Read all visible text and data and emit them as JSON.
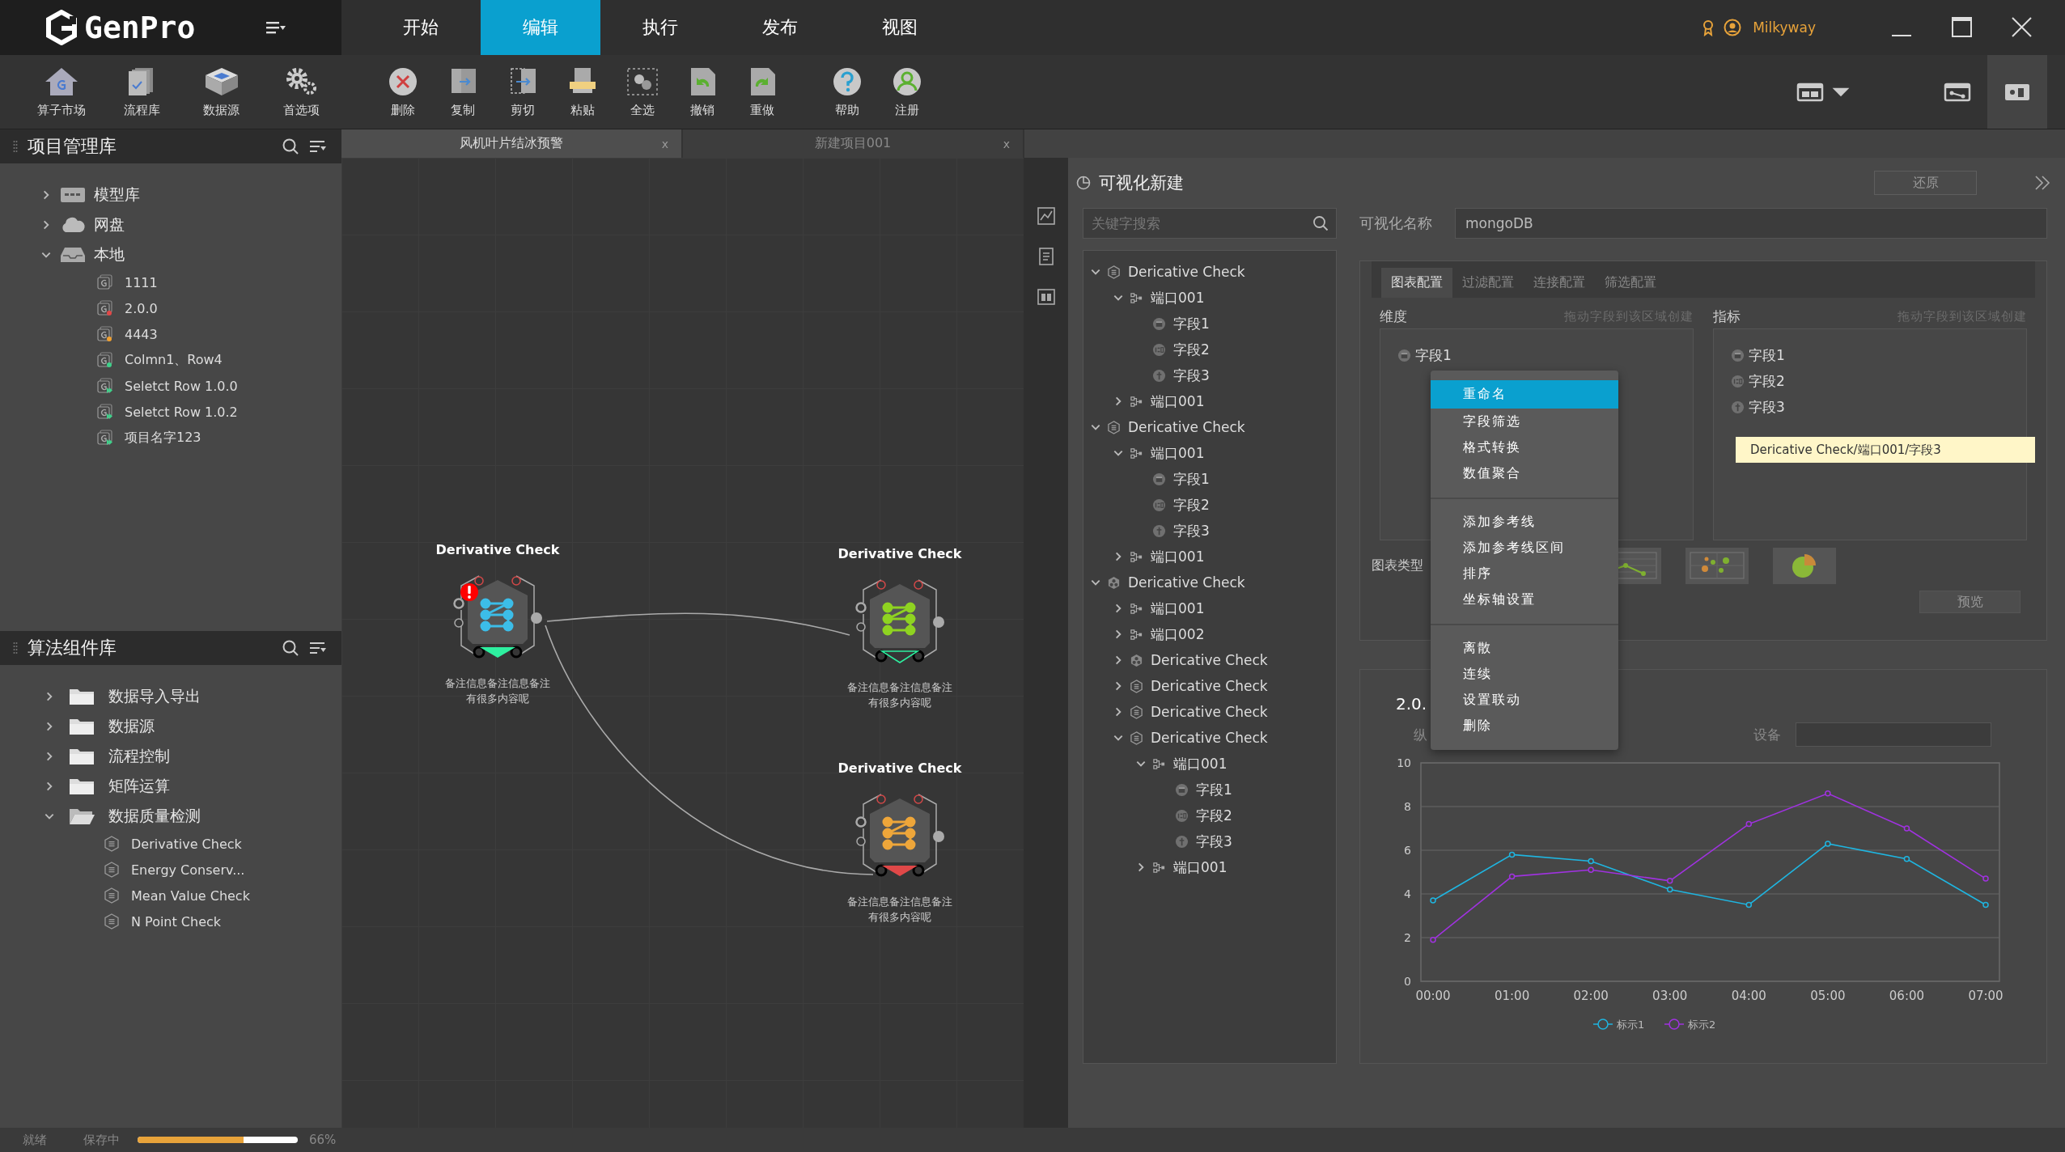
{
  "app": {
    "logo": "GenPro"
  },
  "menu_tabs": [
    {
      "label": "开始",
      "selected": false
    },
    {
      "label": "编辑",
      "selected": true
    },
    {
      "label": "执行",
      "selected": false
    },
    {
      "label": "发布",
      "selected": false
    },
    {
      "label": "视图",
      "selected": false
    }
  ],
  "user": {
    "name": "Milkyway"
  },
  "toolbar": {
    "primary": [
      {
        "label": "算子市场"
      },
      {
        "label": "流程库"
      },
      {
        "label": "数据源"
      },
      {
        "label": "首选项"
      }
    ],
    "edit": [
      {
        "label": "删除"
      },
      {
        "label": "复制"
      },
      {
        "label": "剪切"
      },
      {
        "label": "粘贴"
      },
      {
        "label": "全选"
      },
      {
        "label": "撤销"
      },
      {
        "label": "重做"
      }
    ],
    "help": [
      {
        "label": "帮助"
      },
      {
        "label": "注册"
      }
    ],
    "view_buttons": [
      {
        "selected": false
      },
      {
        "selected": false
      },
      {
        "selected": true
      }
    ]
  },
  "project_panel": {
    "title": "项目管理库",
    "tree": [
      {
        "label": "模型库",
        "kind": "model",
        "expanded": false
      },
      {
        "label": "网盘",
        "kind": "cloud",
        "expanded": false
      },
      {
        "label": "本地",
        "kind": "local",
        "expanded": true,
        "children": [
          {
            "label": "1111",
            "kind": "plain"
          },
          {
            "label": "2.0.0",
            "kind": "dot",
            "color": "#e04848"
          },
          {
            "label": "4443",
            "kind": "dot",
            "color": "#f0a030"
          },
          {
            "label": "Colmn1、Row4",
            "kind": "dot",
            "color": "#3fd08a"
          },
          {
            "label": "Seletct Row 1.0.0",
            "kind": "run",
            "color": "#3fd08a"
          },
          {
            "label": "Seletct Row 1.0.2",
            "kind": "run",
            "color": "#3fd08a"
          },
          {
            "label": "项目名字123",
            "kind": "run",
            "color": "#3fd08a"
          }
        ]
      }
    ]
  },
  "component_panel": {
    "title": "算法组件库",
    "tree": [
      {
        "label": "数据导入导出",
        "expanded": false
      },
      {
        "label": "数据源",
        "expanded": false
      },
      {
        "label": "流程控制",
        "expanded": false
      },
      {
        "label": "矩阵运算",
        "expanded": false
      },
      {
        "label": "数据质量检测",
        "expanded": true,
        "children": [
          {
            "label": "Derivative Check"
          },
          {
            "label": "Energy Conserv..."
          },
          {
            "label": "Mean Value Check"
          },
          {
            "label": "N Point Check"
          }
        ]
      }
    ]
  },
  "document_tabs": [
    {
      "label": "风机叶片结冰预警",
      "close": "x",
      "selected": true
    },
    {
      "label": "新建项目001",
      "close": "x",
      "selected": false
    }
  ],
  "canvas": {
    "nodes": [
      {
        "title": "Derivative Check",
        "note": "备注信息备注信息备注有很多内容呢",
        "color": "#3cbde8",
        "marker": {
          "color": "#2ef0a0",
          "filled": true
        },
        "error": true
      },
      {
        "title": "Derivative Check",
        "note": "备注信息备注信息备注有很多内容呢",
        "color": "#8fd321",
        "marker": {
          "color": "#2ef0a0",
          "filled": false
        },
        "error": false
      },
      {
        "title": "Derivative Check",
        "note": "备注信息备注信息备注有很多内容呢",
        "color": "#eea63a",
        "marker": {
          "color": "#e04848",
          "filled": true
        },
        "error": false
      }
    ]
  },
  "viz_panel": {
    "title": "可视化新建",
    "reset_button": "还原",
    "search": {
      "placeholder": "关键字搜索"
    },
    "field_tree": [
      {
        "label": "Dericative Check",
        "kind": "check",
        "expanded": true,
        "children": [
          {
            "label": "端口001",
            "kind": "port",
            "expanded": true,
            "children": [
              {
                "label": "字段1",
                "kind": "date"
              },
              {
                "label": "字段2",
                "kind": "number"
              },
              {
                "label": "字段3",
                "kind": "text"
              }
            ]
          },
          {
            "label": "端口001",
            "kind": "port",
            "expanded": false
          }
        ]
      },
      {
        "label": "Dericative Check",
        "kind": "check",
        "expanded": true,
        "children": [
          {
            "label": "端口001",
            "kind": "port",
            "expanded": true,
            "children": [
              {
                "label": "字段1",
                "kind": "date"
              },
              {
                "label": "字段2",
                "kind": "number"
              },
              {
                "label": "字段3",
                "kind": "text"
              }
            ]
          },
          {
            "label": "端口001",
            "kind": "port",
            "expanded": false
          }
        ]
      },
      {
        "label": "Dericative Check",
        "kind": "group",
        "expanded": true,
        "children": [
          {
            "label": "端口001",
            "kind": "port",
            "expanded": false
          },
          {
            "label": "端口002",
            "kind": "port",
            "expanded": false
          },
          {
            "label": "Dericative Check",
            "kind": "group",
            "expanded": false
          },
          {
            "label": "Dericative Check",
            "kind": "check",
            "expanded": false
          },
          {
            "label": "Dericative Check",
            "kind": "check",
            "expanded": false
          },
          {
            "label": "Dericative Check",
            "kind": "check",
            "expanded": true,
            "children": [
              {
                "label": "端口001",
                "kind": "port",
                "expanded": true,
                "children": [
                  {
                    "label": "字段1",
                    "kind": "date"
                  },
                  {
                    "label": "字段2",
                    "kind": "number"
                  },
                  {
                    "label": "字段3",
                    "kind": "text"
                  }
                ]
              },
              {
                "label": "端口001",
                "kind": "port",
                "expanded": false
              }
            ]
          }
        ]
      }
    ],
    "name_label": "可视化名称",
    "name_value": "mongoDB",
    "config_tabs": [
      {
        "label": "图表配置",
        "selected": true
      },
      {
        "label": "过滤配置",
        "selected": false
      },
      {
        "label": "连接配置",
        "selected": false
      },
      {
        "label": "筛选配置",
        "selected": false
      }
    ],
    "dimension": {
      "label": "维度",
      "hint": "拖动字段到该区域创建",
      "fields": [
        {
          "label": "字段1",
          "kind": "date"
        }
      ]
    },
    "measure": {
      "label": "指标",
      "hint": "拖动字段到该区域创建",
      "fields": [
        {
          "label": "字段1",
          "kind": "date"
        },
        {
          "label": "字段2",
          "kind": "number"
        },
        {
          "label": "字段3",
          "kind": "text"
        }
      ]
    },
    "chart_type_label": "图表类型",
    "chart_types": [
      {
        "kind": "line"
      },
      {
        "kind": "scatter"
      },
      {
        "kind": "pie"
      }
    ],
    "preview_button": "预览",
    "chart_card": {
      "subtitle": "纵",
      "device_label": "设备",
      "chart_data": {
        "type": "line",
        "title": "2.0.",
        "categories": [
          "00:00",
          "01:00",
          "02:00",
          "03:00",
          "04:00",
          "05:00",
          "06:00",
          "07:00"
        ],
        "series": [
          {
            "name": "标示1",
            "color": "#1fb5e0",
            "marker": true,
            "values": [
              3.7,
              5.8,
              5.5,
              4.2,
              3.5,
              6.3,
              5.6,
              3.5
            ]
          },
          {
            "name": "标示2",
            "color": "#a032e0",
            "marker": true,
            "values": [
              1.9,
              4.8,
              5.1,
              4.6,
              7.2,
              8.6,
              7.0,
              4.7
            ]
          }
        ],
        "ylim": [
          0,
          10
        ],
        "yticks": [
          0,
          2,
          4,
          6,
          8,
          10
        ],
        "grid": true,
        "legend": "bottom"
      }
    },
    "context_menu": {
      "groups": [
        {
          "items": [
            {
              "label": "重命名",
              "selected": true
            },
            {
              "label": "字段筛选",
              "selected": false
            },
            {
              "label": "格式转换",
              "selected": false
            },
            {
              "label": "数值聚合",
              "selected": false
            }
          ]
        },
        {
          "items": [
            {
              "label": "添加参考线",
              "selected": false
            },
            {
              "label": "添加参考线区间",
              "selected": false
            },
            {
              "label": "排序",
              "selected": false
            },
            {
              "label": "坐标轴设置",
              "selected": false
            }
          ]
        },
        {
          "items": [
            {
              "label": "离散",
              "selected": false
            },
            {
              "label": "连续",
              "selected": false
            },
            {
              "label": "设置联动",
              "selected": false
            },
            {
              "label": "删除",
              "selected": false
            }
          ]
        }
      ]
    },
    "tooltip": "Dericative Check/端口001/字段3"
  },
  "status_bar": {
    "state": "就绪",
    "task": "保存中",
    "level": 0.66,
    "reading": "66%"
  }
}
